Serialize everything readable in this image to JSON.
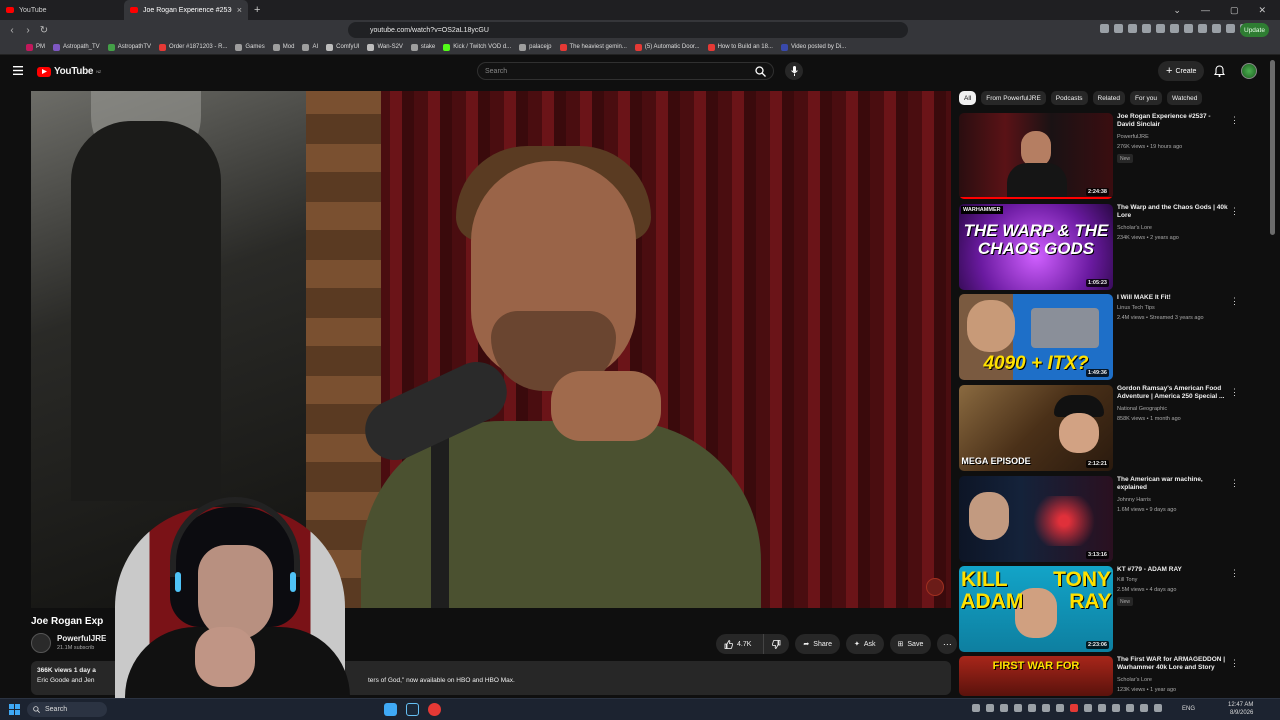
{
  "browser": {
    "tabs": [
      {
        "title": "YouTube",
        "active": false
      },
      {
        "title": "Joe Rogan Experience #2536",
        "active": true
      }
    ],
    "url": "youtube.com/watch?v=OS2aL18ycGU",
    "update_label": "Update",
    "bookmarks": [
      "PM",
      "Astropath_TV",
      "AstropathTV",
      "Order #1871203 - R...",
      "Games",
      "Mod",
      "AI",
      "ComfyUI",
      "Wan-S2V",
      "stake",
      "Kick / Twitch VOD d...",
      "palacejp",
      "The heaviest gemin...",
      "(5) Automatic Door...",
      "How to Build an 18...",
      "Video posted by Di..."
    ]
  },
  "youtube": {
    "logo_text": "YouTube",
    "logo_region": "NZ",
    "search_placeholder": "Search",
    "create_label": "Create"
  },
  "video": {
    "title": "Joe Rogan Exp",
    "channel": "PowerfulJRE",
    "subscribers": "21.1M subscrib",
    "likes": "4.7K",
    "share_label": "Share",
    "ask_label": "Ask",
    "save_label": "Save",
    "description": {
      "meta": "366K views  1 day a",
      "line2": "Eric Goode and Jen",
      "quote": "ters of God,\" now available on HBO and HBO Max."
    }
  },
  "sidebar": {
    "chips": [
      "All",
      "From PowerfulJRE",
      "Podcasts",
      "Related",
      "For you",
      "Watched"
    ],
    "recommendations": [
      {
        "title": "Joe Rogan Experience #2537 - David Sinclair",
        "channel": "PowerfulJRE",
        "meta": "276K views • 19 hours ago",
        "badge": "New",
        "duration": "2:24:38",
        "thumb_text": "",
        "thumb_bg": "#1a1214"
      },
      {
        "title": "The Warp and the Chaos Gods | 40k Lore",
        "channel": "Scholar's Lore",
        "meta": "234K views • 2 years ago",
        "badge": "",
        "duration": "1:05:23",
        "thumb_text": "THE WARP & THE CHAOS GODS",
        "thumb_tag": "WARHAMMER",
        "thumb_bg": "#6a1aa0"
      },
      {
        "title": "I Will MAKE It Fit!",
        "channel": "Linus Tech Tips",
        "meta": "2.4M views • Streamed 3 years ago",
        "badge": "",
        "duration": "1:49:36",
        "thumb_text": "4090 + ITX?",
        "thumb_bg": "#1e6fc8"
      },
      {
        "title": "Gordon Ramsay's American Food Adventure | America 250 Special ...",
        "channel": "National Geographic",
        "meta": "858K views • 1 month ago",
        "badge": "",
        "duration": "2:12:21",
        "thumb_text": "MEGA EPISODE",
        "thumb_bg": "#6e4a22"
      },
      {
        "title": "The American war machine, explained",
        "channel": "Johnny Harris",
        "meta": "1.6M views • 9 days ago",
        "badge": "",
        "duration": "3:13:16",
        "thumb_text": "",
        "thumb_bg": "#14223a"
      },
      {
        "title": "KT #779 - ADAM RAY",
        "channel": "Kill Tony",
        "meta": "2.5M views • 4 days ago",
        "badge": "New",
        "duration": "2:23:06",
        "thumb_text": "KILL TONY ADAM RAY",
        "thumb_bg": "#12a4c8"
      },
      {
        "title": "The First WAR for ARMAGEDDON | Warhammer 40k Lore and Story",
        "channel": "Scholar's Lore",
        "meta": "123K views • 1 year ago",
        "badge": "",
        "duration": "",
        "thumb_text": "FIRST WAR FOR",
        "thumb_bg": "#a8261a"
      }
    ]
  },
  "taskbar": {
    "search_label": "Search",
    "lang": "ENG",
    "time": "12:47 AM",
    "date": "8/9/2026"
  }
}
